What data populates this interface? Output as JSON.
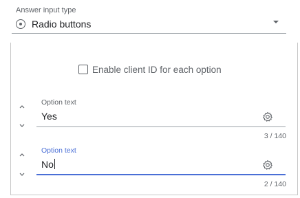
{
  "answer_input": {
    "label": "Answer input type",
    "selected_value": "Radio buttons",
    "icon": "radio-button-icon"
  },
  "client_id_checkbox": {
    "label": "Enable client ID for each option",
    "checked": false
  },
  "options": [
    {
      "label": "Option text",
      "value": "Yes",
      "counter": "3 / 140",
      "focused": false
    },
    {
      "label": "Option text",
      "value": "No",
      "counter": "2 / 140",
      "focused": true
    }
  ],
  "colors": {
    "accent": "#4a6fd6",
    "muted_text": "#5f6368",
    "border": "#c7c7c7"
  }
}
